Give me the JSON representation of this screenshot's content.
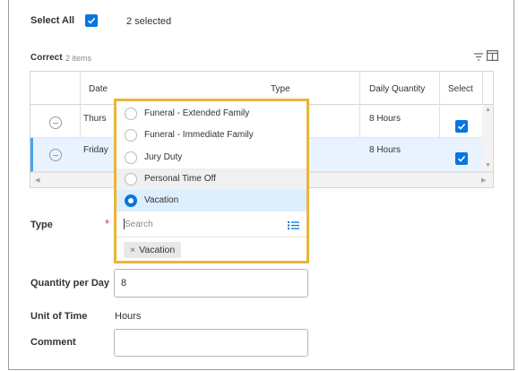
{
  "header": {
    "select_all_label": "Select All",
    "selected_count": "2 selected"
  },
  "grid": {
    "title": "Correct",
    "item_count": "2 items",
    "columns": [
      "Date",
      "Type",
      "Daily Quantity",
      "Select"
    ],
    "rows": [
      {
        "date": "Thurs",
        "quantity": "8 Hours",
        "selected": true
      },
      {
        "date": "Friday",
        "quantity": "8 Hours",
        "selected": true
      }
    ]
  },
  "form": {
    "type_label": "Type",
    "required_mark": "*",
    "quantity_label": "Quantity per Day",
    "quantity_value": "8",
    "unit_label": "Unit of Time",
    "unit_value": "Hours",
    "comment_label": "Comment",
    "comment_value": ""
  },
  "dropdown": {
    "options": [
      {
        "label": "Funeral - Extended Family",
        "selected": false
      },
      {
        "label": "Funeral - Immediate Family",
        "selected": false
      },
      {
        "label": "Jury Duty",
        "selected": false
      },
      {
        "label": "Personal Time Off",
        "selected": false
      },
      {
        "label": "Vacation",
        "selected": true
      }
    ],
    "search_placeholder": "Search",
    "selected_pill": "Vacation",
    "pill_remove_glyph": "×"
  },
  "colors": {
    "accent": "#0875e1",
    "highlight_border": "#e8b53c",
    "required": "#d13f3f"
  }
}
